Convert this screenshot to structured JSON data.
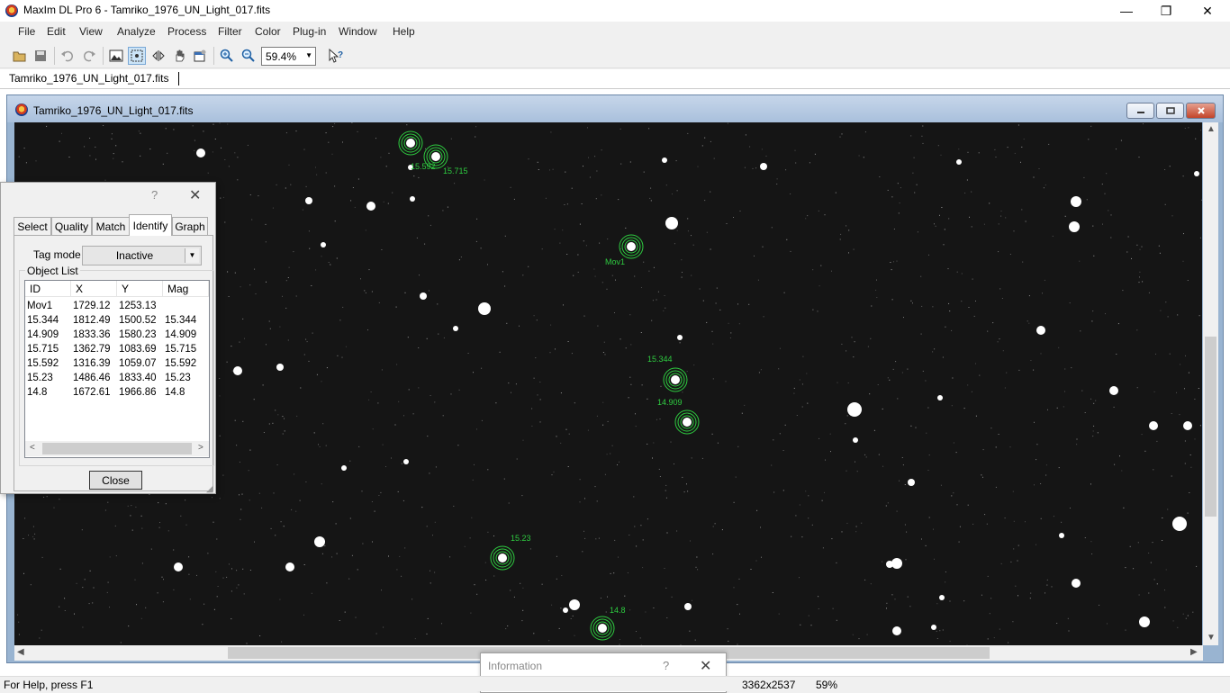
{
  "app": {
    "title": "MaxIm DL Pro 6 - Tamriko_1976_UN_Light_017.fits",
    "minimize": "—",
    "restore": "❐",
    "close": "✕"
  },
  "menu": {
    "file": "File",
    "edit": "Edit",
    "view": "View",
    "analyze": "Analyze",
    "process": "Process",
    "filter": "Filter",
    "color": "Color",
    "plugin": "Plug-in",
    "window": "Window",
    "help": "Help"
  },
  "toolbar": {
    "zoom_value": "59.4%",
    "icons": [
      "open-icon",
      "save-icon",
      "undo-icon",
      "redo-icon",
      "image-icon",
      "select-icon",
      "flip-icon",
      "hand-icon",
      "properties-icon",
      "zoom-in-icon",
      "zoom-out-icon",
      "context-help-icon"
    ]
  },
  "document_tab": {
    "label": "Tamriko_1976_UN_Light_017.fits"
  },
  "image_window": {
    "title": "Tamriko_1976_UN_Light_017.fits",
    "star_labels": [
      "15.592",
      "15.715",
      "Mov1",
      "15.344",
      "14.909",
      "15.23",
      "14.8"
    ]
  },
  "dialog": {
    "help": "?",
    "close_x": "✕",
    "tabs": [
      "Select",
      "Quality",
      "Match",
      "Identify",
      "Graph"
    ],
    "active_tab": "Identify",
    "tag_mode_label": "Tag mode",
    "tag_mode_value": "Inactive",
    "object_list_label": "Object List",
    "columns": [
      "ID",
      "X",
      "Y",
      "Mag"
    ],
    "rows": [
      [
        "Mov1",
        "1729.12",
        "1253.13",
        ""
      ],
      [
        "15.344",
        "1812.49",
        "1500.52",
        "15.344"
      ],
      [
        "14.909",
        "1833.36",
        "1580.23",
        "14.909"
      ],
      [
        "15.715",
        "1362.79",
        "1083.69",
        "15.715"
      ],
      [
        "15.592",
        "1316.39",
        "1059.07",
        "15.592"
      ],
      [
        "15.23",
        "1486.46",
        "1833.40",
        "15.23"
      ],
      [
        "14.8",
        "1672.61",
        "1966.86",
        "14.8"
      ]
    ],
    "close_button": "Close"
  },
  "info_dialog": {
    "title": "Information",
    "help": "?",
    "close_x": "✕"
  },
  "status": {
    "help_text": "For Help, press F1",
    "dimensions": "3362x2537",
    "zoom": "59%"
  },
  "colors": {
    "marker": "#2ecc40",
    "sky": "#151515"
  }
}
